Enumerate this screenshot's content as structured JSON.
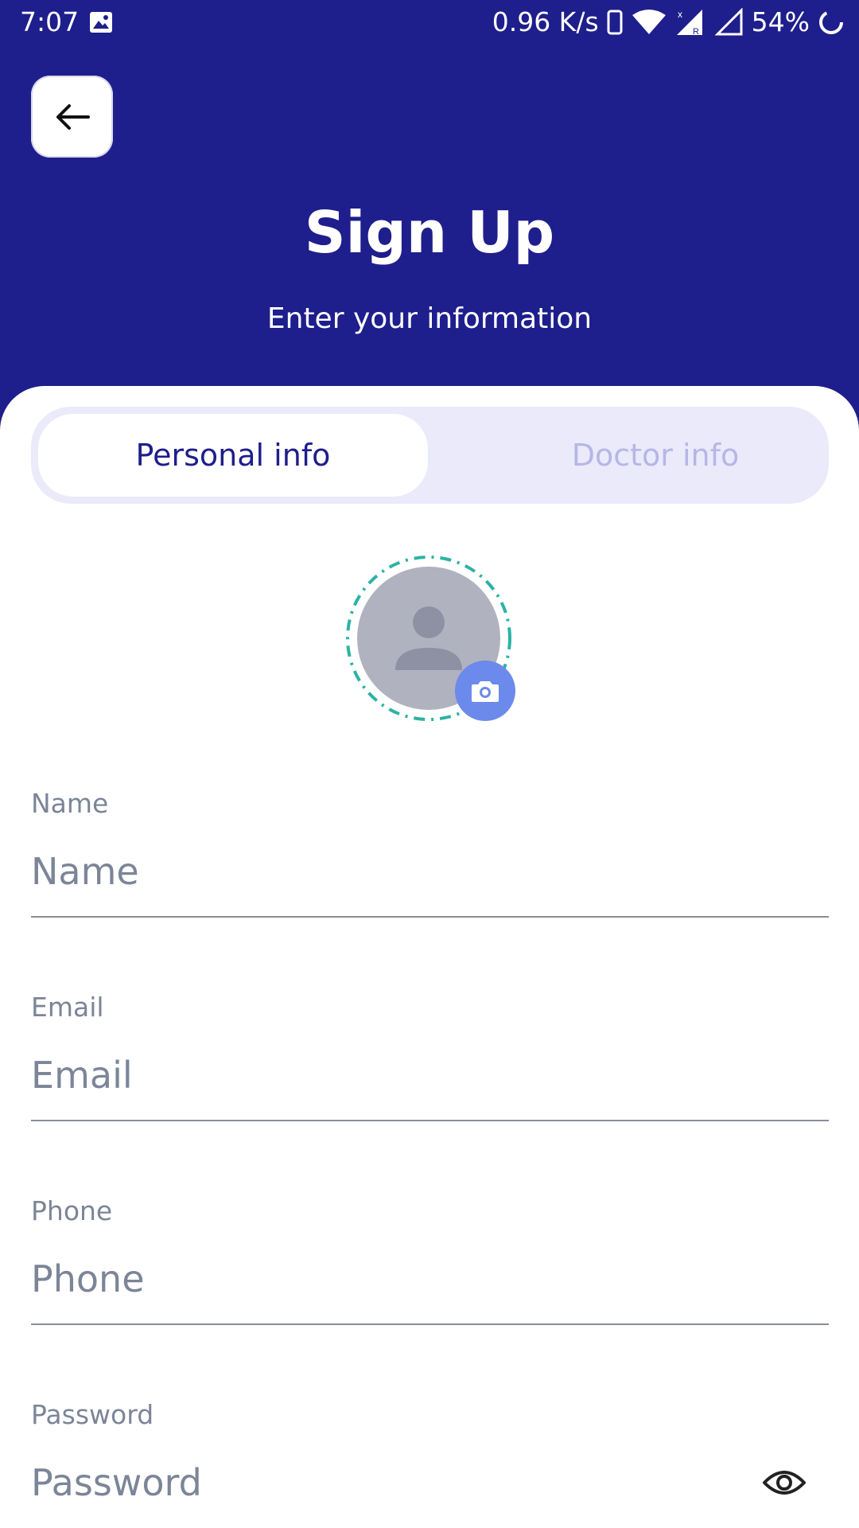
{
  "status_bar": {
    "time": "7:07",
    "network_speed": "0.96 K/s",
    "battery": "54%",
    "icons": [
      "gallery-icon",
      "phone-icon",
      "wifi-icon",
      "signal-icon",
      "signal-empty-icon",
      "battery-icon"
    ]
  },
  "header": {
    "title": "Sign Up",
    "subtitle": "Enter your information",
    "back_icon": "arrow-left-icon"
  },
  "tabs": [
    {
      "label": "Personal info",
      "active": true
    },
    {
      "label": "Doctor info",
      "active": false
    }
  ],
  "avatar": {
    "placeholder_icon": "person-icon",
    "camera_icon": "camera-icon"
  },
  "form": {
    "name": {
      "label": "Name",
      "placeholder": "Name",
      "value": ""
    },
    "email": {
      "label": "Email",
      "placeholder": "Email",
      "value": ""
    },
    "phone": {
      "label": "Phone",
      "placeholder": "Phone",
      "value": ""
    },
    "password": {
      "label": "Password",
      "placeholder": "Password",
      "value": "",
      "toggle_icon": "eye-icon"
    }
  },
  "colors": {
    "primary": "#1E1E8C",
    "tab_bg": "#EAEAFB",
    "tab_inactive_text": "#B6B6E6",
    "avatar_ring": "#2BB3A5",
    "camera_button": "#6B8AEB",
    "label_text": "#7C8598"
  }
}
